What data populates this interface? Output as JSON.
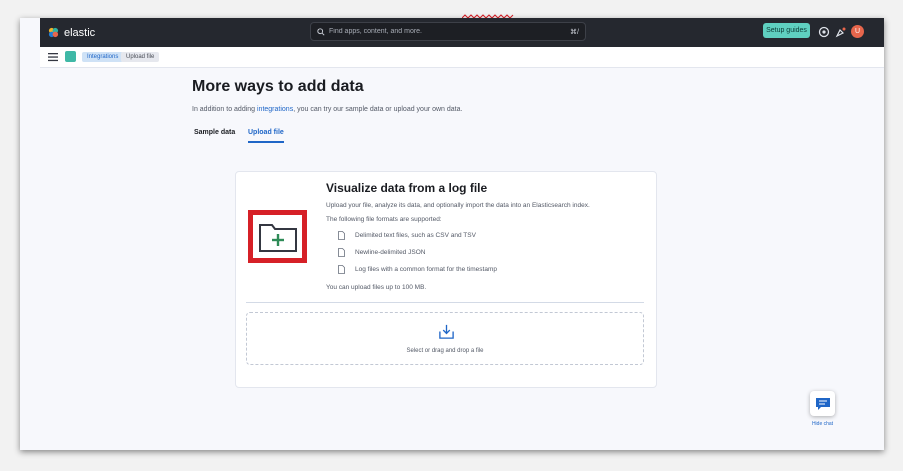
{
  "header": {
    "brand": "elastic",
    "search_placeholder": "Find apps, content, and more.",
    "search_shortcut": "⌘/",
    "setup_guides": "Setup guides",
    "avatar_initial": "U"
  },
  "breadcrumbs": [
    {
      "label": "Integrations"
    },
    {
      "label": "Upload file"
    }
  ],
  "page": {
    "title": "More ways to add data",
    "description_prefix": "In addition to adding ",
    "description_link": "integrations",
    "description_suffix": ", you can try our sample data or upload your own data.",
    "tabs": [
      {
        "label": "Sample data",
        "selected": false
      },
      {
        "label": "Upload file",
        "selected": true
      }
    ]
  },
  "upload_card": {
    "title": "Visualize data from a log file",
    "intro": "Upload your file, analyze its data, and optionally import the data into an Elasticsearch index.",
    "formats_heading": "The following file formats are supported:",
    "formats": [
      "Delimited text files, such as CSV and TSV",
      "Newline-delimited JSON",
      "Log files with a common format for the timestamp"
    ],
    "size_limit": "You can upload files up to 100 MB.",
    "dropzone_label": "Select or drag and drop a file"
  },
  "chat": {
    "label": "Hide chat"
  },
  "colors": {
    "header_bg": "#25282f",
    "accent_link": "#1f66c7",
    "setup_button": "#5fd0c0",
    "highlight_box": "#d62027",
    "folder_plus": "#2e8b57"
  }
}
